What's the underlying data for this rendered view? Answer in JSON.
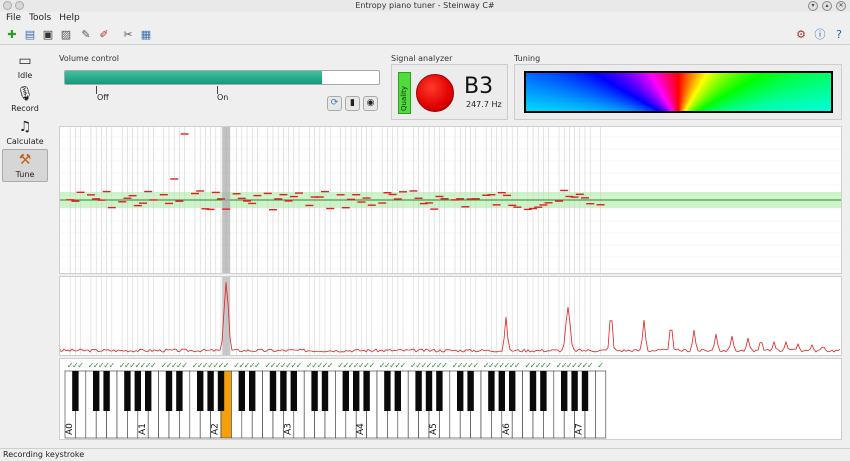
{
  "window": {
    "title": "Entropy piano tuner - Steinway C#"
  },
  "menu": {
    "items": [
      "File",
      "Tools",
      "Help"
    ]
  },
  "sidebar": {
    "modes": [
      {
        "label": "Idle",
        "icon": "monitor-icon"
      },
      {
        "label": "Record",
        "icon": "microphone-icon"
      },
      {
        "label": "Calculate",
        "icon": "music-note-icon"
      },
      {
        "label": "Tune",
        "icon": "tuning-hammer-icon",
        "active": true
      }
    ]
  },
  "volume": {
    "title": "Volume control",
    "level": 0.82,
    "off_label": "Off",
    "on_label": "On"
  },
  "signal": {
    "title": "Signal analyzer",
    "quality_label": "Quality",
    "note": "B3",
    "frequency": "247.7 Hz"
  },
  "tuning": {
    "title": "Tuning"
  },
  "keyboard": {
    "labels": [
      "A0",
      "A1",
      "A2",
      "A3",
      "A4",
      "A5",
      "A6",
      "A7"
    ],
    "selected_key": "B3"
  },
  "status": {
    "text": "Recording keystroke"
  },
  "colors": {
    "accent": "#149a78",
    "selected_key": "#f5a00a",
    "marker": "#e02020",
    "quality": "#50dc3a"
  }
}
